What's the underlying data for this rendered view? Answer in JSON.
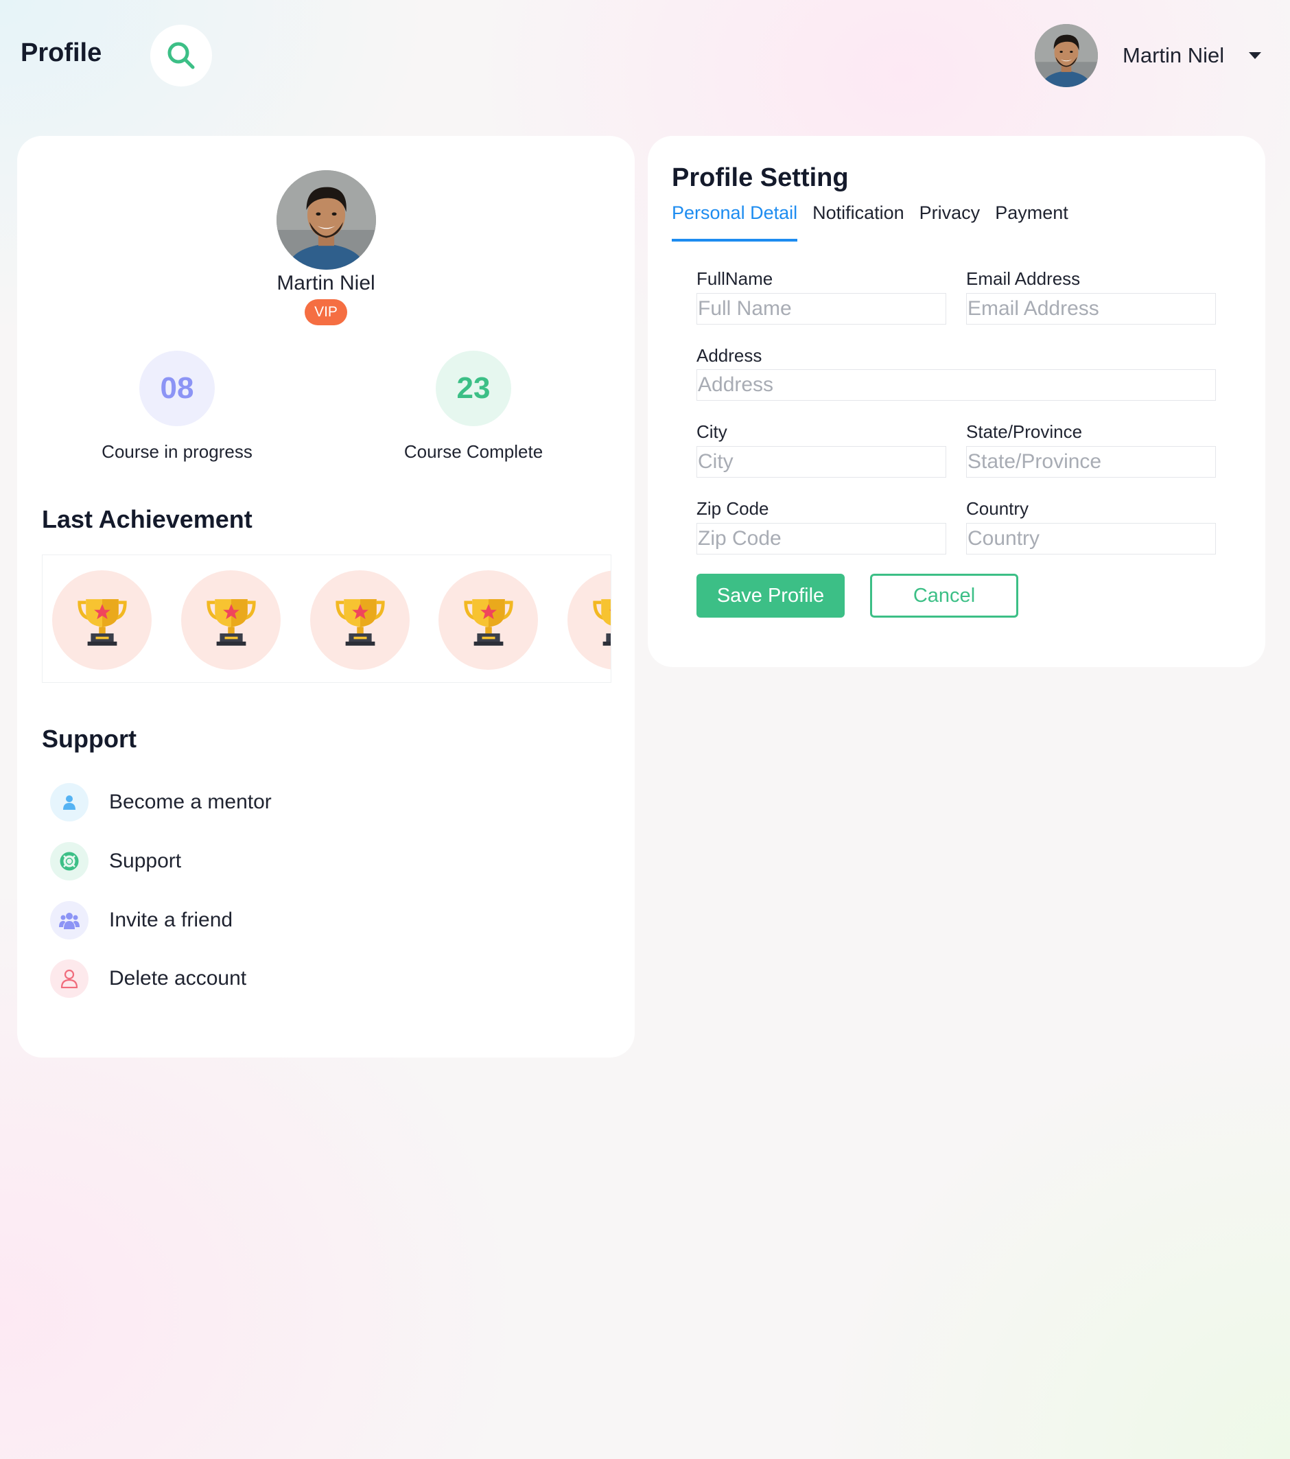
{
  "header": {
    "title": "Profile",
    "search_icon": "search-icon",
    "user_name": "Martin Niel"
  },
  "profile": {
    "name": "Martin Niel",
    "badge": "VIP",
    "stats": [
      {
        "value": "08",
        "label": "Course in progress",
        "color": "#8c94f5",
        "bg": "#eeeffd"
      },
      {
        "value": "23",
        "label": "Course Complete",
        "color": "#3cbf86",
        "bg": "#e6f7ef"
      }
    ]
  },
  "achievements": {
    "title": "Last Achievement",
    "icon": "trophy-icon"
  },
  "support": {
    "title": "Support",
    "items": [
      {
        "label": "Become a mentor",
        "icon": "user-icon",
        "color": "#55b3f3",
        "bg": "#e6f5fd"
      },
      {
        "label": "Support",
        "icon": "lifebuoy-icon",
        "color": "#3cbf86",
        "bg": "#e6f7ef"
      },
      {
        "label": "Invite a friend",
        "icon": "users-icon",
        "color": "#8c94f5",
        "bg": "#eeeffd"
      },
      {
        "label": "Delete account",
        "icon": "user-remove-icon",
        "color": "#f06c7c",
        "bg": "#fde9ec"
      }
    ]
  },
  "settings": {
    "title": "Profile Setting",
    "tabs": [
      "Personal Detail",
      "Notification",
      "Privacy",
      "Payment"
    ],
    "active_tab": "Personal Detail",
    "fields": {
      "fullname": {
        "label": "FullName",
        "placeholder": "Full Name",
        "value": ""
      },
      "email": {
        "label": "Email Address",
        "placeholder": "Email Address",
        "value": ""
      },
      "address": {
        "label": "Address",
        "placeholder": "Address",
        "value": ""
      },
      "city": {
        "label": "City",
        "placeholder": "City",
        "value": ""
      },
      "state": {
        "label": "State/Province",
        "placeholder": "State/Province",
        "value": ""
      },
      "zip": {
        "label": "Zip Code",
        "placeholder": "Zip Code",
        "value": ""
      },
      "country": {
        "label": "Country",
        "placeholder": "Country",
        "value": ""
      }
    },
    "save_label": "Save Profile",
    "cancel_label": "Cancel"
  },
  "colors": {
    "accent_green": "#3cbf86",
    "tab_active_blue": "#1d8cf0",
    "badge_orange": "#f56e42",
    "trophy_bg": "#fde8e3"
  }
}
